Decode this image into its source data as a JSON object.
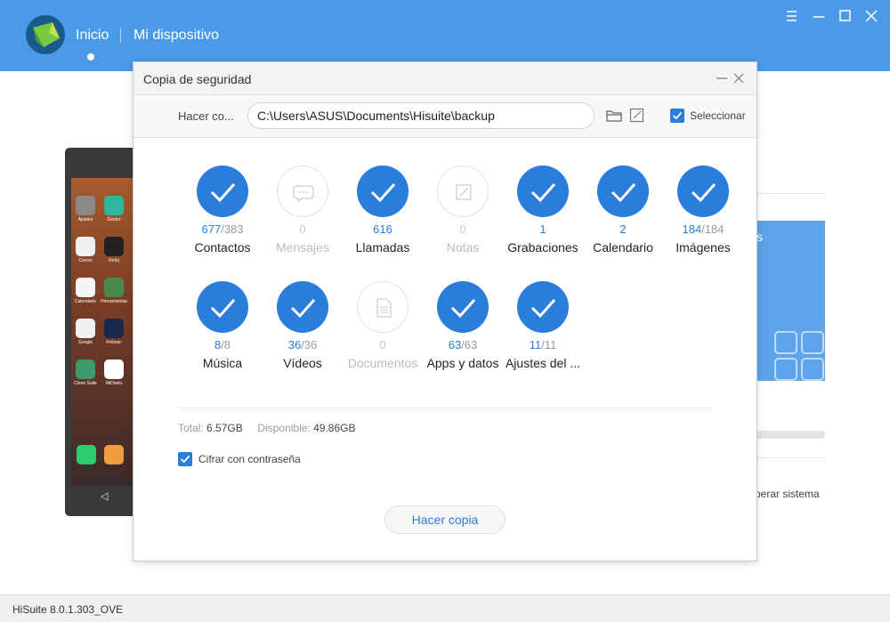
{
  "app": {
    "nav": {
      "home": "Inicio",
      "device": "Mi dispositivo"
    },
    "version": "HiSuite 8.0.1.303_OVE",
    "accent_color": "#4a9ae8"
  },
  "background": {
    "card_text": "s",
    "recover_text": "perar sistema"
  },
  "modal": {
    "title": "Copia de seguridad",
    "path_label": "Hacer co...",
    "path_value": "C:\\Users\\ASUS\\Documents\\Hisuite\\backup",
    "select_label": "Seleccionar",
    "select_checked": true,
    "items": [
      {
        "label": "Contactos",
        "selected": "677",
        "total": "/383",
        "checked": true,
        "icon": "check-icon"
      },
      {
        "label": "Mensajes",
        "selected": "0",
        "total": "",
        "checked": false,
        "icon": "message-icon"
      },
      {
        "label": "Llamadas",
        "selected": "616",
        "total": "",
        "checked": true,
        "icon": "check-icon"
      },
      {
        "label": "Notas",
        "selected": "0",
        "total": "",
        "checked": false,
        "icon": "notes-icon"
      },
      {
        "label": "Grabaciones",
        "selected": "1",
        "total": "",
        "checked": true,
        "icon": "check-icon"
      },
      {
        "label": "Calendario",
        "selected": "2",
        "total": "",
        "checked": true,
        "icon": "check-icon"
      },
      {
        "label": "Imágenes",
        "selected": "184",
        "total": "/184",
        "checked": true,
        "icon": "check-icon"
      },
      {
        "label": "Música",
        "selected": "8",
        "total": "/8",
        "checked": true,
        "icon": "check-icon"
      },
      {
        "label": "Vídeos",
        "selected": "36",
        "total": "/36",
        "checked": true,
        "icon": "check-icon"
      },
      {
        "label": "Documentos",
        "selected": "0",
        "total": "",
        "checked": false,
        "icon": "document-icon"
      },
      {
        "label": "Apps y datos",
        "selected": "63",
        "total": "/63",
        "checked": true,
        "icon": "check-icon"
      },
      {
        "label": "Ajustes del ...",
        "selected": "11",
        "total": "/11",
        "checked": true,
        "icon": "check-icon"
      }
    ],
    "total_label": "Total:",
    "total_value": "6.57GB",
    "available_label": "Disponible:",
    "available_value": "49.86GB",
    "encrypt_label": "Cifrar con contraseña",
    "encrypt_checked": true,
    "backup_button": "Hacer copia"
  },
  "phone_apps": [
    {
      "label": "Ajustes",
      "color": "#8a8a8a"
    },
    {
      "label": "Gestor",
      "color": "#2fb5a0"
    },
    {
      "label": "Correo",
      "color": "#f0f0f0"
    },
    {
      "label": "Reloj",
      "color": "#222222"
    },
    {
      "label": "Calendario",
      "color": "#f5f5f5"
    },
    {
      "label": "Herramientas",
      "color": "#4a8a4a"
    },
    {
      "label": "Google",
      "color": "#f0f0f0"
    },
    {
      "label": "Fintonic",
      "color": "#1a2a4a"
    },
    {
      "label": "Clone Suite",
      "color": "#3a9a6a"
    },
    {
      "label": "MiDiario",
      "color": "#ffffff"
    }
  ]
}
